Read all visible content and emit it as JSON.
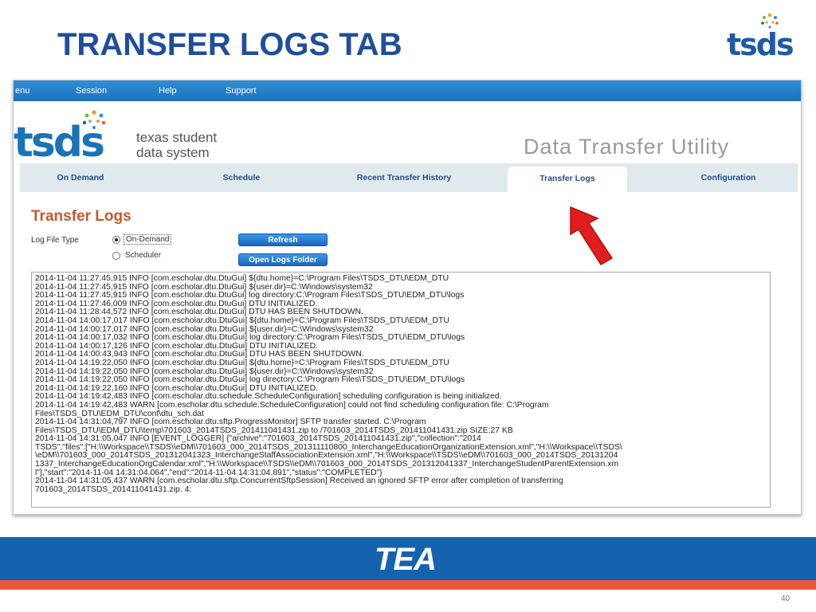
{
  "slide": {
    "title": "TRANSFER LOGS TAB",
    "logo_text": "tsds",
    "footer_logo": "TEA",
    "page_number": "40"
  },
  "menu": {
    "items": [
      "enu",
      "Session",
      "Help",
      "Support"
    ]
  },
  "app": {
    "logo_word": "tsds",
    "logo_sub_line1": "texas student",
    "logo_sub_line2": "data system",
    "utility_title": "Data Transfer Utility"
  },
  "tabs": [
    {
      "label": "On Demand",
      "active": false
    },
    {
      "label": "Schedule",
      "active": false
    },
    {
      "label": "Recent Transfer History",
      "active": false
    },
    {
      "label": "Transfer Logs",
      "active": true
    },
    {
      "label": "Configuration",
      "active": false
    }
  ],
  "transfer_logs": {
    "title": "Transfer Logs",
    "log_file_type_label": "Log File Type",
    "option_on_demand": "On-Demand",
    "option_scheduler": "Scheduler",
    "selected_option": "On-Demand",
    "refresh_label": "Refresh",
    "open_folder_label": "Open Logs Folder"
  },
  "log_lines": [
    "2014-11-04 11:27:45,915 INFO  [com.escholar.dtu.DtuGui] ${dtu.home}=C:\\Program Files\\TSDS_DTU\\EDM_DTU",
    "2014-11-04 11:27:45,915 INFO  [com.escholar.dtu.DtuGui] ${user.dir}=C:\\Windows\\system32",
    "2014-11-04 11:27:45,915 INFO  [com.escholar.dtu.DtuGui] log directory:C:\\Program Files\\TSDS_DTU\\EDM_DTU\\logs",
    "2014-11-04 11:27:46,009 INFO  [com.escholar.dtu.DtuGui] DTU INITIALIZED.",
    "2014-11-04 11:28:44,572 INFO  [com.escholar.dtu.DtuGui] DTU HAS BEEN SHUTDOWN.",
    "2014-11-04 14:00:17,017 INFO  [com.escholar.dtu.DtuGui] ${dtu.home}=C:\\Program Files\\TSDS_DTU\\EDM_DTU",
    "2014-11-04 14:00:17,017 INFO  [com.escholar.dtu.DtuGui] ${user.dir}=C:\\Windows\\system32",
    "2014-11-04 14:00:17,032 INFO  [com.escholar.dtu.DtuGui] log directory:C:\\Program Files\\TSDS_DTU\\EDM_DTU\\logs",
    "2014-11-04 14:00:17,126 INFO  [com.escholar.dtu.DtuGui] DTU INITIALIZED.",
    "2014-11-04 14:00:43,943 INFO  [com.escholar.dtu.DtuGui] DTU HAS BEEN SHUTDOWN.",
    "2014-11-04 14:19:22,050 INFO  [com.escholar.dtu.DtuGui] ${dtu.home}=C:\\Program Files\\TSDS_DTU\\EDM_DTU",
    "2014-11-04 14:19:22,050 INFO  [com.escholar.dtu.DtuGui] ${user.dir}=C:\\Windows\\system32",
    "2014-11-04 14:19:22,050 INFO  [com.escholar.dtu.DtuGui] log directory:C:\\Program Files\\TSDS_DTU\\EDM_DTU\\logs",
    "2014-11-04 14:19:22,160 INFO  [com.escholar.dtu.DtuGui] DTU INITIALIZED.",
    "2014-11-04 14:19:42,483 INFO  [com.escholar.dtu.schedule.ScheduleConfiguration] scheduling configuration is being initialized.",
    "2014-11-04 14:19:42,483 WARN  [com.escholar.dtu.schedule.ScheduleConfiguration] could not find scheduling configuration file: C:\\Program",
    "Files\\TSDS_DTU\\EDM_DTU\\conf\\dtu_sch.dat",
    "2014-11-04 14:31:04,797 INFO  [com.escholar.dtu.sftp.ProgressMonitor] SFTP transfer started. C:\\Program",
    "Files\\TSDS_DTU\\EDM_DTU\\temp\\701603_2014TSDS_201411041431.zip to /701603_2014TSDS_201411041431.zip SIZE:27 KB",
    "2014-11-04 14:31:05,047 INFO  [EVENT_LOGGER] {\"archive\":\"701603_2014TSDS_201411041431.zip\",\"collection\":\"2014",
    "TSDS\",\"files\":[\"H:\\\\Workspace\\\\TSDS\\\\eDM\\\\701603_000_2014TSDS_201311110800_InterchangeEducationOrganizationExtension.xml\",\"H:\\\\Workspace\\\\TSDS\\",
    "\\eDM\\\\701603_000_2014TSDS_201312041323_InterchangeStaffAssociationExtension.xml\",\"H:\\\\Workspace\\\\TSDS\\\\eDM\\\\701603_000_2014TSDS_20131204",
    "1337_InterchangeEducationOrgCalendar.xml\",\"H:\\\\Workspace\\\\TSDS\\\\eDM\\\\701603_000_2014TSDS_201312041337_InterchangeStudentParentExtension.xm",
    "l\"],\"start\":\"2014-11-04 14:31:04.064\",\"end\":\"2014-11-04 14:31:04.891\",\"status\":\"COMPLETED\"}",
    "2014-11-04 14:31:05,437 WARN  [com.escholar.dtu.sftp.ConcurrentSftpSession] Received an ignored SFTP error after completion of transferring",
    "701603_2014TSDS_201411041431.zip. 4:"
  ],
  "colors": {
    "title_blue": "#1f4e9c",
    "menu_blue": "#1c72bd",
    "section_orange": "#c5582a",
    "band_blue": "#1563ae",
    "band_orange": "#e8593b",
    "arrow_red": "#e01e1e"
  },
  "icons": {
    "arrow": "red-arrow-icon",
    "logo_dots": "tsds-dots-icon"
  }
}
